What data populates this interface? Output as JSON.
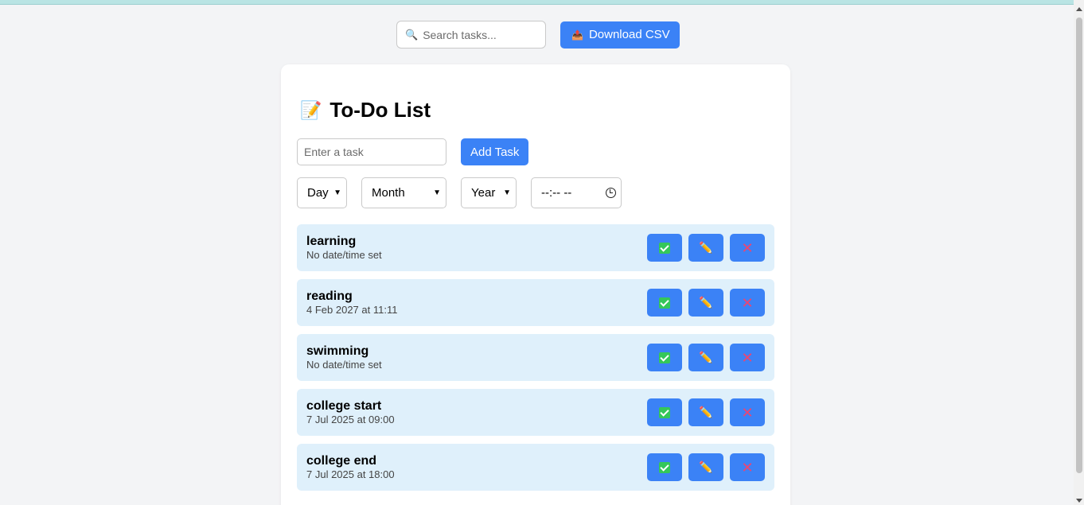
{
  "search": {
    "placeholder": "Search tasks...",
    "icon": "magnifier-icon"
  },
  "download": {
    "label": "Download CSV",
    "icon": "csv-icon"
  },
  "card": {
    "title": "To-Do List",
    "title_icon": "memo-icon",
    "task_input_placeholder": "Enter a task",
    "add_label": "Add Task",
    "day": "Day",
    "month": "Month",
    "year": "Year",
    "time": "--:-- --"
  },
  "tasks": [
    {
      "name": "learning",
      "when": "No date/time set"
    },
    {
      "name": "reading",
      "when": "4 Feb 2027 at 11:11"
    },
    {
      "name": "swimming",
      "when": "No date/time set"
    },
    {
      "name": "college start",
      "when": "7 Jul 2025 at 09:00"
    },
    {
      "name": "college end",
      "when": "7 Jul 2025 at 18:00"
    }
  ],
  "colors": {
    "accent": "#3b82f6",
    "task_bg": "#dff0fb",
    "page_bg": "#f3f4f6",
    "complete": "#34c759",
    "edit": "#f29a50",
    "delete": "#ef4470"
  }
}
